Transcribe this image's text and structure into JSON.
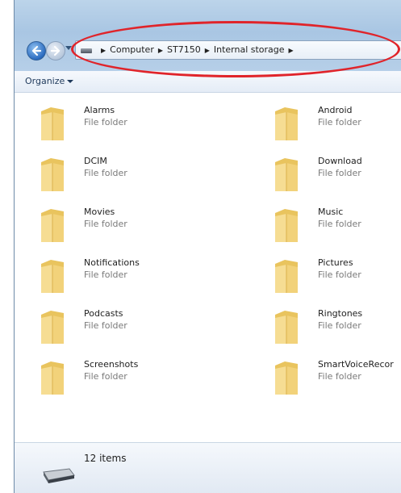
{
  "address_bar": {
    "crumbs": [
      "Computer",
      "ST7150",
      "Internal storage"
    ]
  },
  "toolbar": {
    "organize_label": "Organize"
  },
  "folders": [
    {
      "name": "Alarms",
      "type": "File folder"
    },
    {
      "name": "Android",
      "type": "File folder"
    },
    {
      "name": "DCIM",
      "type": "File folder"
    },
    {
      "name": "Download",
      "type": "File folder"
    },
    {
      "name": "Movies",
      "type": "File folder"
    },
    {
      "name": "Music",
      "type": "File folder"
    },
    {
      "name": "Notifications",
      "type": "File folder"
    },
    {
      "name": "Pictures",
      "type": "File folder"
    },
    {
      "name": "Podcasts",
      "type": "File folder"
    },
    {
      "name": "Ringtones",
      "type": "File folder"
    },
    {
      "name": "Screenshots",
      "type": "File folder"
    },
    {
      "name": "SmartVoiceRecor",
      "type": "File folder"
    }
  ],
  "status": {
    "item_count": "12 items"
  },
  "colors": {
    "highlight": "#e0242a",
    "folder": "#f3d37a"
  },
  "icons": {
    "back": "back-arrow-icon",
    "forward": "forward-arrow-icon",
    "folder": "folder-icon",
    "drive": "drive-icon"
  }
}
